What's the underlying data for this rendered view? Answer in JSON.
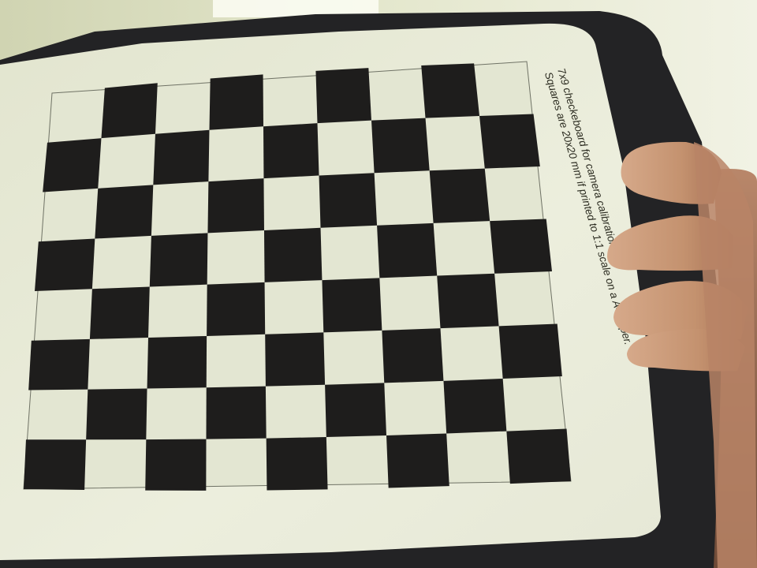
{
  "photo": {
    "subject": "checkerboard calibration target",
    "caption_line_1": "7x9 checkeboard for camera calibration.",
    "caption_line_2": "Squares are  20x20 mm if printed to 1:1 scale on a A4 paper.",
    "board_columns": 9,
    "board_rows": 8,
    "colors": {
      "wall": "#dfe2c6",
      "clipboard": "#252527",
      "paper": "#e9ebda",
      "dark_square": "#1e1d1c",
      "light_square": "#e3e6d2",
      "skin": "#c69877"
    }
  }
}
